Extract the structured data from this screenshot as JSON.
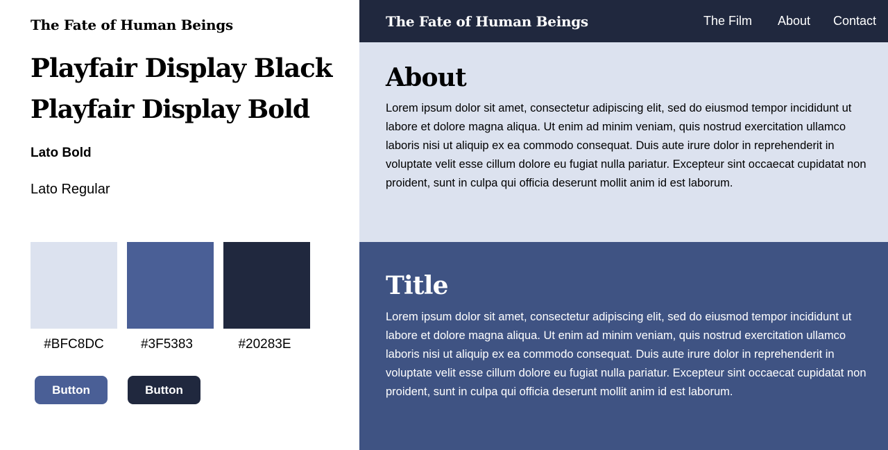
{
  "colors": {
    "light": "#DCE2EF",
    "mid": "#4A5F96",
    "dark": "#20283E",
    "mid_section": "#3F5383",
    "text_dark": "#000000",
    "text_light": "#FFFFFF"
  },
  "guide": {
    "brand": "The Fate of Human Beings",
    "heading_black": "Playfair Display Black",
    "heading_bold": "Playfair Display Bold",
    "body_bold": "Lato Bold",
    "body_regular": "Lato Regular",
    "swatches": [
      {
        "label": "#BFC8DC",
        "color": "#DCE2EF"
      },
      {
        "label": "#3F5383",
        "color": "#4A5F96"
      },
      {
        "label": "#20283E",
        "color": "#20283E"
      }
    ],
    "buttons": [
      {
        "label": "Button",
        "color": "#4A5F96"
      },
      {
        "label": "Button",
        "color": "#20283E"
      }
    ]
  },
  "preview": {
    "nav": {
      "brand": "The Fate of Human Beings",
      "links": [
        "The Film",
        "About",
        "Contact"
      ]
    },
    "about": {
      "heading": "About",
      "body": "Lorem ipsum dolor sit amet, consectetur adipiscing elit, sed do eiusmod tempor incididunt ut labore et dolore magna aliqua. Ut enim ad minim veniam, quis nostrud exercitation ullamco laboris nisi ut aliquip ex ea commodo consequat. Duis aute irure dolor in reprehenderit in voluptate velit esse cillum dolore eu fugiat nulla pariatur. Excepteur sint occaecat cupidatat non proident, sunt in culpa qui officia deserunt mollit anim id est laborum."
    },
    "title_section": {
      "heading": "Title",
      "body": "Lorem ipsum dolor sit amet, consectetur adipiscing elit, sed do eiusmod tempor incididunt ut labore et dolore magna aliqua. Ut enim ad minim veniam, quis nostrud exercitation ullamco laboris nisi ut aliquip ex ea commodo consequat. Duis aute irure dolor in reprehenderit in voluptate velit esse cillum dolore eu fugiat nulla pariatur. Excepteur sint occaecat cupidatat non proident, sunt in culpa qui officia deserunt mollit anim id est laborum."
    }
  }
}
